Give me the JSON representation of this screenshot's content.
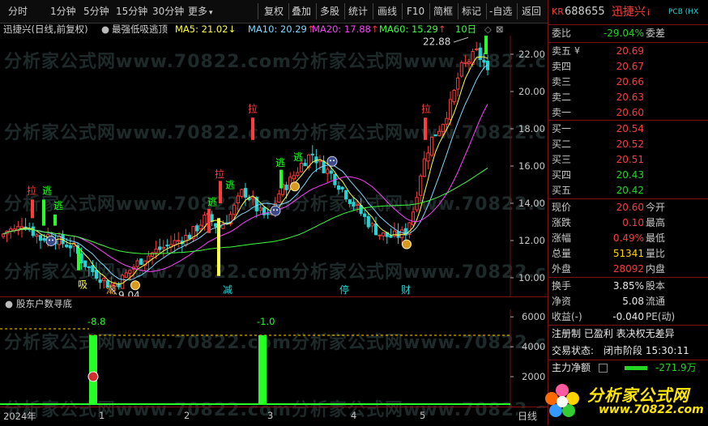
{
  "toolbar": {
    "items": [
      "分时",
      "1分钟",
      "5分钟",
      "15分钟",
      "30分钟",
      "更多",
      "复权",
      "叠加",
      "多股",
      "统计",
      "画线",
      "F10",
      "简框",
      "标记",
      "-自选",
      "返回"
    ],
    "more_suffix": "▾"
  },
  "legend": {
    "name": "迅捷兴(日线,前复权)",
    "indicator": "最强低吸逃顶",
    "ma5": "MA5: 21.02",
    "ma10": "MA10: 20.29",
    "ma20": "MA20: 17.88",
    "ma60": "MA60: 15.29",
    "days": "10日",
    "down_arrow": "↓",
    "up_arrow": "↑"
  },
  "colors": {
    "up": "#ff3b3b",
    "down": "#26d4d4",
    "ma5": "#ffff40",
    "ma10": "#7fd8ff",
    "ma20": "#ff40ff",
    "ma60": "#40ff40",
    "signal_green": "#26ff26",
    "border": "#7a1010"
  },
  "main_axis": {
    "ticks": [
      "22.00",
      "20.00",
      "18.00",
      "16.00",
      "14.00",
      "12.00",
      "10.00"
    ],
    "range": [
      9.0,
      23.0
    ]
  },
  "annotations": {
    "high_price": "22.88",
    "low_price": "9.04",
    "la": "拉",
    "tao": "逃",
    "xi": "吸",
    "bottom_labels": [
      "潮",
      "减",
      "停",
      "财"
    ]
  },
  "indicator": {
    "title": "股东户数寻底",
    "values": [
      {
        "label": "-8.8"
      },
      {
        "label": "-1.0"
      }
    ],
    "ticks": [
      "6000",
      "4000",
      "2000"
    ],
    "range": [
      0,
      6500
    ]
  },
  "time_axis": {
    "labels": [
      "2024年",
      "1",
      "2",
      "3",
      "4",
      "5"
    ]
  },
  "panel": {
    "market_tag": "KR",
    "code": "688655",
    "name": "迅捷兴",
    "name_suffix": "i",
    "tag2": "PCB (HX",
    "weibi_label": "委比",
    "weibi_value": "-29.04%",
    "weicha_label": "委差",
    "sell": [
      {
        "label": "卖五",
        "mark": "¥",
        "price": "20.69"
      },
      {
        "label": "卖四",
        "mark": "",
        "price": "20.67"
      },
      {
        "label": "卖三",
        "mark": "",
        "price": "20.66"
      },
      {
        "label": "卖二",
        "mark": "",
        "price": "20.63"
      },
      {
        "label": "卖一",
        "mark": "",
        "price": "20.60"
      }
    ],
    "buy": [
      {
        "label": "买一",
        "price": "20.54"
      },
      {
        "label": "买二",
        "price": "20.52"
      },
      {
        "label": "买三",
        "price": "20.51"
      },
      {
        "label": "买四",
        "price": "20.43"
      },
      {
        "label": "买五",
        "price": "20.42"
      }
    ],
    "quote": [
      {
        "l1": "现价",
        "v1": "20.60",
        "l2": "今开"
      },
      {
        "l1": "涨跌",
        "v1": "0.10",
        "l2": "最高"
      },
      {
        "l1": "涨幅",
        "v1": "0.49%",
        "l2": "最低"
      },
      {
        "l1": "总量",
        "v1": "51341",
        "l2": "量比"
      },
      {
        "l1": "外盘",
        "v1": "28092",
        "l2": "内盘"
      }
    ],
    "stats": [
      {
        "l1": "换手",
        "v1": "3.85%",
        "l2": "股本"
      },
      {
        "l1": "净资",
        "v1": "5.08",
        "l2": "流通"
      },
      {
        "l1": "收益(-)",
        "v1": "-0.040",
        "l2": "PE(动)"
      }
    ],
    "info_line": "注册制 已盈利 表决权无差异",
    "status_label": "交易状态:",
    "status_value": "闭市阶段 15:30:11",
    "net_label": "主力净额",
    "net_value": "-271.9万",
    "bottom_tab": "日线"
  },
  "watermark": "分析家公式网www.70822.com",
  "logo": {
    "title": "分析家公式网",
    "url": "www.70822.com"
  }
}
